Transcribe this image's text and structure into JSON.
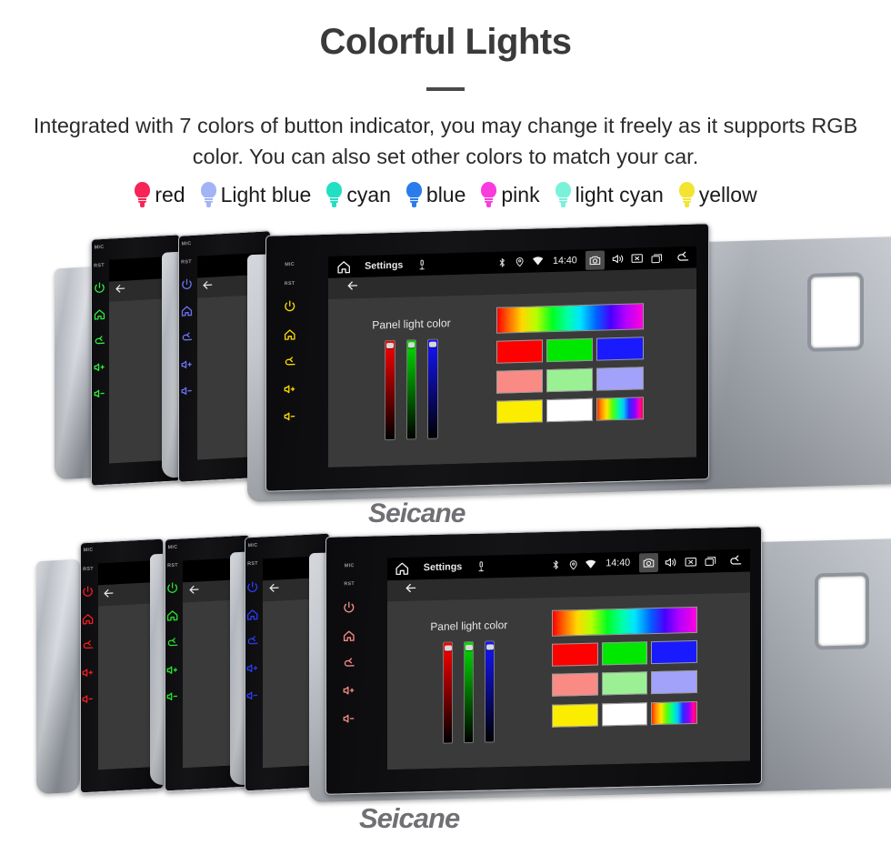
{
  "header": {
    "title": "Colorful Lights",
    "subtitle": "Integrated with 7 colors of button indicator, you may change it freely as it supports RGB color. You can also set other colors to match your car."
  },
  "legend": {
    "items": [
      {
        "label": "red",
        "color": "#f72457",
        "icon": "bulb-icon"
      },
      {
        "label": "Light blue",
        "color": "#a3b4f5",
        "icon": "bulb-icon"
      },
      {
        "label": "cyan",
        "color": "#22dfc4",
        "icon": "bulb-icon"
      },
      {
        "label": "blue",
        "color": "#2a7ced",
        "icon": "bulb-icon"
      },
      {
        "label": "pink",
        "color": "#f93cdd",
        "icon": "bulb-icon"
      },
      {
        "label": "light cyan",
        "color": "#7af2d9",
        "icon": "bulb-icon"
      },
      {
        "label": "yellow",
        "color": "#f2e431",
        "icon": "bulb-icon"
      }
    ]
  },
  "device": {
    "statusbar": {
      "home_icon": "home-icon",
      "title": "Settings",
      "mic_icon": "microphone-icon",
      "bluetooth_icon": "bluetooth-icon",
      "location_icon": "location-pin-icon",
      "wifi_icon": "wifi-icon",
      "time": "14:40",
      "camera_icon": "camera-icon",
      "volume_icon": "speaker-icon",
      "close_icon": "close-box-icon",
      "recents_icon": "recent-apps-icon",
      "back_icon": "back-arrow-icon"
    },
    "actionbar": {
      "back_icon": "back-arrow-icon"
    },
    "panel": {
      "label": "Panel light color",
      "sliders": [
        {
          "name": "red-slider",
          "color": "#ff0000",
          "value": 100
        },
        {
          "name": "green-slider",
          "color": "#00e000",
          "value": 100
        },
        {
          "name": "blue-slider",
          "color": "#1414ff",
          "value": 100
        }
      ],
      "rainbow_bar": "spectrum-gradient",
      "swatch_rows": [
        [
          {
            "name": "swatch-red",
            "color": "#ff0000"
          },
          {
            "name": "swatch-green",
            "color": "#00e800"
          },
          {
            "name": "swatch-blue",
            "color": "#1a1aff"
          }
        ],
        [
          {
            "name": "swatch-salmon",
            "color": "#fa8b84"
          },
          {
            "name": "swatch-lightgreen",
            "color": "#9cf094"
          },
          {
            "name": "swatch-periwinkle",
            "color": "#a2a2fa"
          }
        ],
        [
          {
            "name": "swatch-yellow",
            "color": "#fbed00"
          },
          {
            "name": "swatch-white",
            "color": "#ffffff"
          },
          {
            "name": "swatch-rainbow",
            "color": "rainbow"
          }
        ]
      ]
    },
    "side_keys": {
      "mic_label": "MIC",
      "rst_label": "RST",
      "power_icon": "power-icon",
      "home_icon": "home-icon",
      "back_icon": "back-arrow-icon",
      "volume_up_icon": "volume-up-icon",
      "volume_down_icon": "volume-down-icon"
    }
  },
  "groups": {
    "top": {
      "name": "top-unit-row",
      "units": [
        {
          "name": "unit-green",
          "key_color": "#2ee83f"
        },
        {
          "name": "unit-blue",
          "key_color": "#6a73f0"
        },
        {
          "name": "unit-yellow",
          "key_color": "#f5d800"
        }
      ]
    },
    "bottom": {
      "name": "bottom-unit-row",
      "units": [
        {
          "name": "unit-red",
          "key_color": "#ee1d1d"
        },
        {
          "name": "unit-green",
          "key_color": "#27dd2e"
        },
        {
          "name": "unit-blue",
          "key_color": "#2a3cf0"
        },
        {
          "name": "unit-salmon",
          "key_color": "#f08a84"
        }
      ]
    }
  },
  "watermark": {
    "text": "Seicane"
  }
}
